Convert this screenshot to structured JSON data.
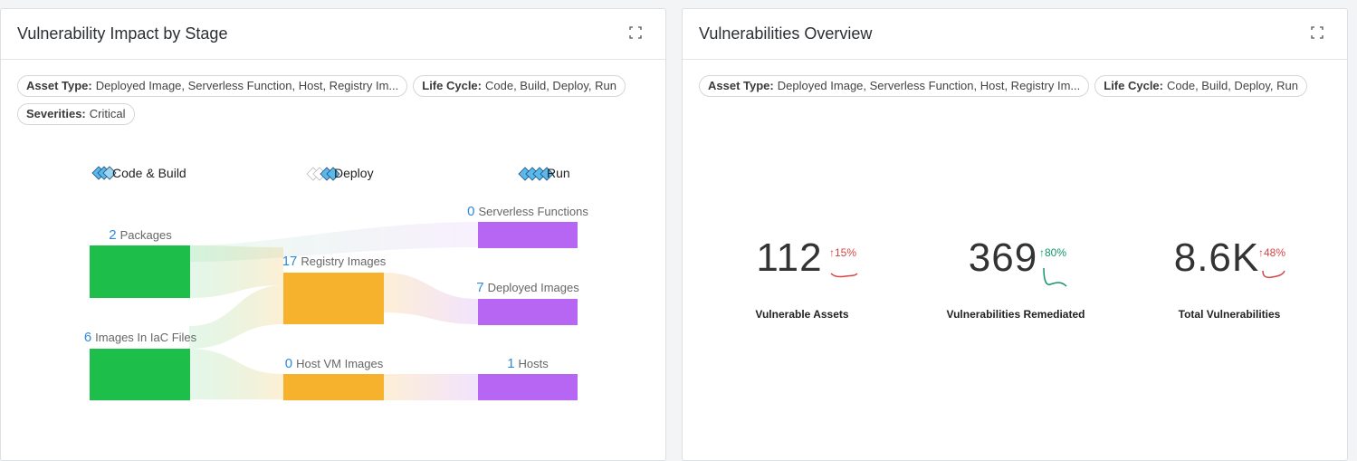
{
  "left_panel": {
    "title": "Vulnerability Impact by Stage",
    "filters": [
      {
        "label": "Asset Type:",
        "value": "Deployed Image, Serverless Function, Host, Registry Im..."
      },
      {
        "label": "Life Cycle:",
        "value": "Code, Build, Deploy, Run"
      },
      {
        "label": "Severities:",
        "value": "Critical"
      }
    ],
    "stages": [
      "Code & Build",
      "Deploy",
      "Run"
    ],
    "nodes": [
      {
        "count": "2",
        "label": "Packages",
        "color": "#1dbf4a"
      },
      {
        "count": "6",
        "label": "Images In IaC Files",
        "color": "#1dbf4a"
      },
      {
        "count": "17",
        "label": "Registry Images",
        "color": "#f6b12d"
      },
      {
        "count": "0",
        "label": "Host VM Images",
        "color": "#f6b12d"
      },
      {
        "count": "0",
        "label": "Serverless Functions",
        "color": "#b765f3"
      },
      {
        "count": "7",
        "label": "Deployed Images",
        "color": "#b765f3"
      },
      {
        "count": "1",
        "label": "Hosts",
        "color": "#b765f3"
      }
    ]
  },
  "right_panel": {
    "title": "Vulnerabilities Overview",
    "filters": [
      {
        "label": "Asset Type:",
        "value": "Deployed Image, Serverless Function, Host, Registry Im..."
      },
      {
        "label": "Life Cycle:",
        "value": "Code, Build, Deploy, Run"
      }
    ],
    "kpis": [
      {
        "value": "112",
        "trend": "↑15%",
        "trend_color": "#d64545",
        "label": "Vulnerable Assets",
        "direction": "up"
      },
      {
        "value": "369",
        "trend": "↑80%",
        "trend_color": "#12966b",
        "label": "Vulnerabilities Remediated",
        "direction": "up"
      },
      {
        "value": "8.6K",
        "trend": "↑48%",
        "trend_color": "#d64545",
        "label": "Total Vulnerabilities",
        "direction": "up"
      }
    ]
  },
  "colors": {
    "code_build": "#1dbf4a",
    "deploy": "#f6b12d",
    "run": "#b765f3",
    "count_blue": "#2e8bd9"
  }
}
